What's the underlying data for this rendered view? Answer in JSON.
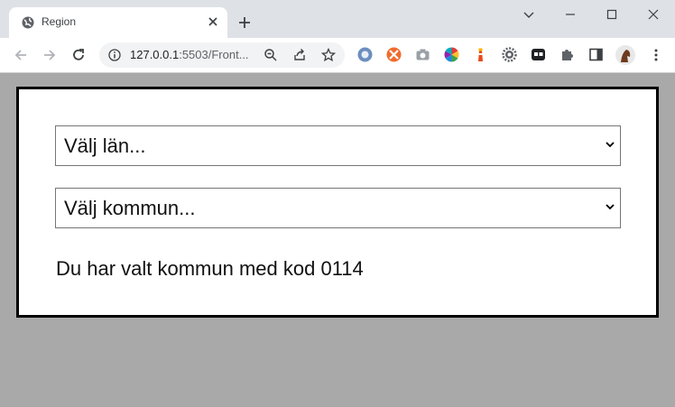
{
  "browser": {
    "tab": {
      "title": "Region"
    },
    "address_bar": {
      "url_host": "127.0.0.1",
      "url_rest": ":5503/Front..."
    }
  },
  "page": {
    "lan_select": {
      "selected": "Välj län..."
    },
    "kommun_select": {
      "selected": "Välj kommun..."
    },
    "result_text": "Du har valt kommun med kod 0114"
  },
  "colors": {
    "page_background": "#a9a9a9",
    "tabstrip": "#dee1e6",
    "card_border": "#000000"
  }
}
